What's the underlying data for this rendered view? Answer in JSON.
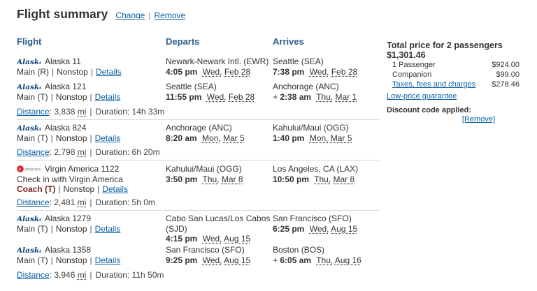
{
  "header": {
    "title": "Flight summary",
    "change_label": "Change",
    "separator": "|",
    "remove_label": "Remove"
  },
  "columns": {
    "flight": "Flight",
    "departs": "Departs",
    "arrives": "Arrives"
  },
  "segments": [
    {
      "airline": "Alaska",
      "flight": "Alaska 11",
      "cabin": "Main (R)",
      "stops": "Nonstop",
      "details_label": "Details",
      "depart_airport": "Newark-Newark Intl. (EWR)",
      "depart_time": "4:05 pm",
      "depart_day": "Wed,",
      "depart_date": "Feb 28",
      "arrive_airport": "Seattle (SEA)",
      "arrive_prefix": "",
      "arrive_time": "7:38 pm",
      "arrive_day": "Wed,",
      "arrive_date": "Feb 28"
    },
    {
      "airline": "Alaska",
      "flight": "Alaska 121",
      "cabin": "Main (T)",
      "stops": "Nonstop",
      "details_label": "Details",
      "depart_airport": "Seattle (SEA)",
      "depart_time": "11:55 pm",
      "depart_day": "Wed,",
      "depart_date": "Feb 28",
      "arrive_airport": "Anchorage (ANC)",
      "arrive_prefix": "+",
      "arrive_time": "2:38 am",
      "arrive_day": "Thu,",
      "arrive_date": "Mar 1"
    },
    {
      "airline": "Alaska",
      "flight": "Alaska 824",
      "cabin": "Main (T)",
      "stops": "Nonstop",
      "details_label": "Details",
      "depart_airport": "Anchorage (ANC)",
      "depart_time": "8:20 am",
      "depart_day": "Mon,",
      "depart_date": "Mar 5",
      "arrive_airport": "Kahului/Maui (OGG)",
      "arrive_prefix": "",
      "arrive_time": "1:40 pm",
      "arrive_day": "Mon,",
      "arrive_date": "Mar 5"
    },
    {
      "airline": "Virgin America",
      "flight": "Virgin America 1122",
      "checkin": "Check in with Virgin America",
      "cabin": "Coach (T)",
      "stops": "Nonstop",
      "details_label": "Details",
      "depart_airport": "Kahului/Maui (OGG)",
      "depart_time": "3:50 pm",
      "depart_day": "Thu,",
      "depart_date": "Mar 8",
      "arrive_airport": "Los Angeles, CA (LAX)",
      "arrive_prefix": "",
      "arrive_time": "10:50 pm",
      "arrive_day": "Thu,",
      "arrive_date": "Mar 8"
    },
    {
      "airline": "Alaska",
      "flight": "Alaska 1279",
      "cabin": "Main (T)",
      "stops": "Nonstop",
      "details_label": "Details",
      "depart_airport": "Cabo San Lucas/Los Cabos",
      "depart_airport_2": "(SJD)",
      "depart_time": "4:15 pm",
      "depart_day": "Wed,",
      "depart_date": "Aug 15",
      "arrive_airport": "San Francisco (SFO)",
      "arrive_prefix": "",
      "arrive_time": "6:25 pm",
      "arrive_day": "Wed,",
      "arrive_date": "Aug 15"
    },
    {
      "airline": "Alaska",
      "flight": "Alaska 1358",
      "cabin": "Main (T)",
      "stops": "Nonstop",
      "details_label": "Details",
      "depart_airport": "San Francisco (SFO)",
      "depart_time": "9:25 pm",
      "depart_day": "Wed,",
      "depart_date": "Aug 15",
      "arrive_airport": "Boston (BOS)",
      "arrive_prefix": "+",
      "arrive_time": "6:05 am",
      "arrive_day": "Thu,",
      "arrive_date": "Aug 16"
    }
  ],
  "summaries": [
    {
      "distance_label": "Distance",
      "distance_value": ": 3,838",
      "distance_unit": "mi",
      "duration": "Duration: 14h 33m"
    },
    {
      "distance_label": "Distance",
      "distance_value": ": 2,798",
      "distance_unit": "mi",
      "duration": "Duration: 6h 20m"
    },
    {
      "distance_label": "Distance",
      "distance_value": ": 2,481",
      "distance_unit": "mi",
      "duration": "Duration: 5h 0m"
    },
    {
      "distance_label": "Distance",
      "distance_value": ": 3,946",
      "distance_unit": "mi",
      "duration": "Duration: 11h 50m"
    }
  ],
  "price": {
    "title": "Total price for 2 passengers",
    "total": "$1,301.46",
    "lines": [
      {
        "label": "1 Passenger",
        "value": "$924.00"
      },
      {
        "label": "Companion",
        "value": "$99.00"
      },
      {
        "label": "Taxes, fees and charges",
        "value": "$278.46"
      }
    ],
    "lowprice_label": "Low-price guarantee",
    "discount_label": "Discount code applied:",
    "remove_label": "[Remove]"
  },
  "colors": {
    "link": "#0b5fa5",
    "column_header": "#2a5c8a",
    "alaska_logo": "#12457a",
    "virgin_red": "#d2232a",
    "coach_text": "#7a1f1f"
  }
}
